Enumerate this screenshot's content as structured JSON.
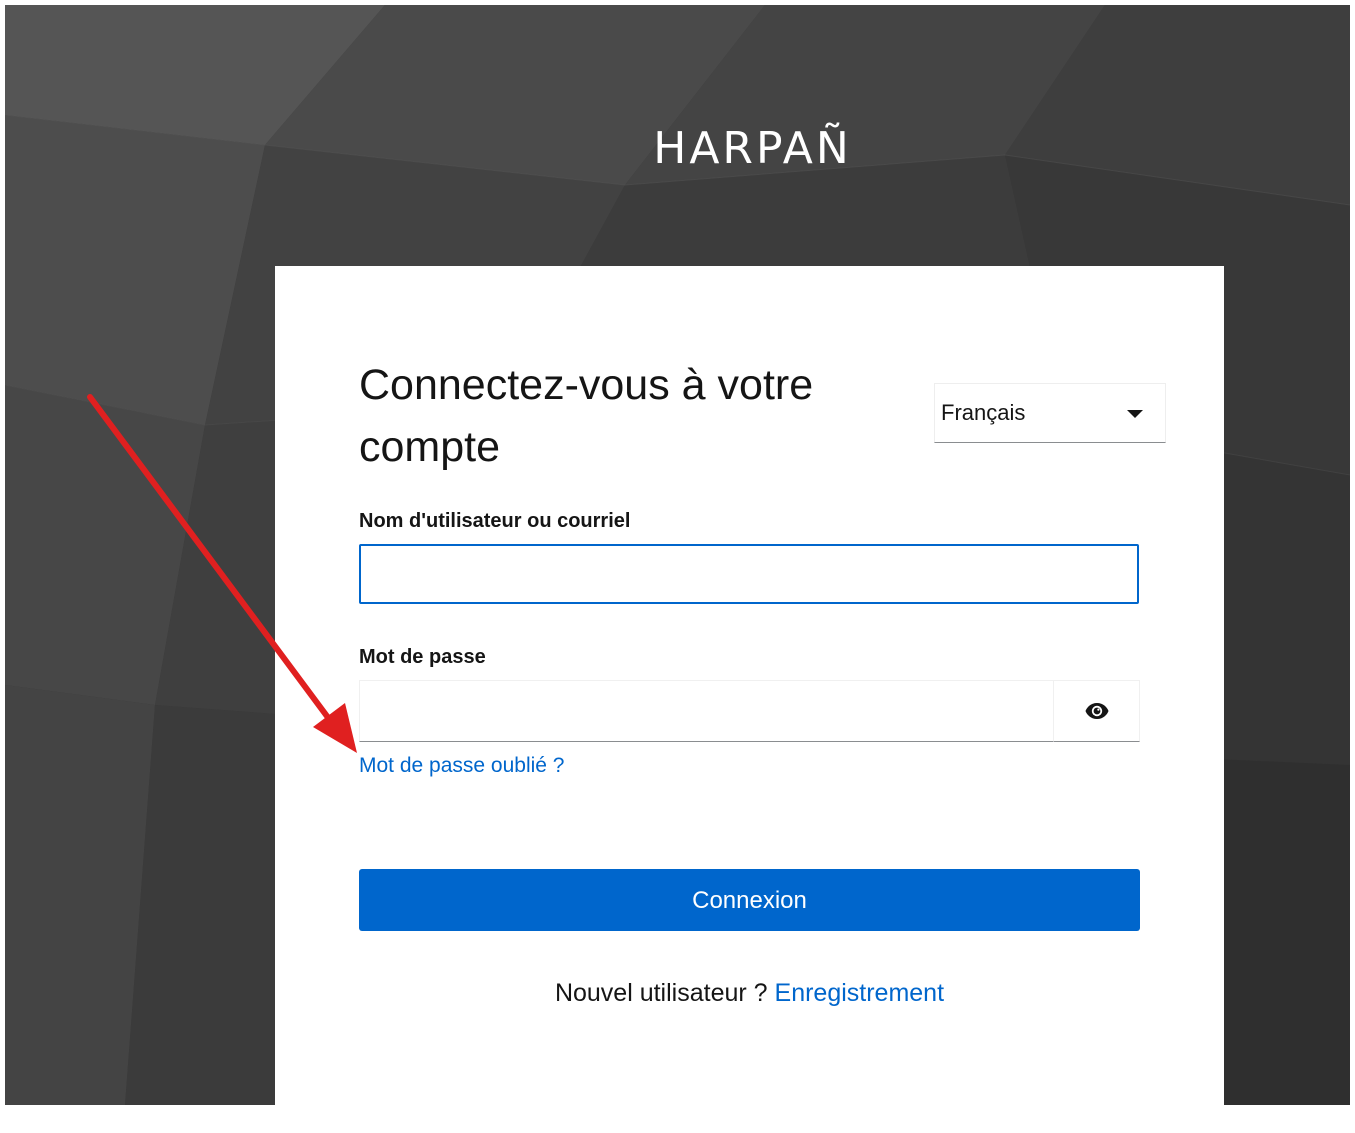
{
  "brand": {
    "name": "HARPAÑ"
  },
  "login": {
    "title": "Connectez-vous à votre compte",
    "language": {
      "selected": "Français",
      "icon": "caret-down-icon"
    },
    "username": {
      "label": "Nom d'utilisateur ou courriel",
      "value": ""
    },
    "password": {
      "label": "Mot de passe",
      "value": "",
      "toggle_icon": "eye-icon"
    },
    "forgot_link": "Mot de passe oublié ?",
    "submit_label": "Connexion",
    "register": {
      "prompt": "Nouvel utilisateur ?",
      "link": "Enregistrement"
    }
  },
  "colors": {
    "accent": "#0066cc",
    "background": "#3a3a3a",
    "annotation_arrow": "#e02020"
  }
}
